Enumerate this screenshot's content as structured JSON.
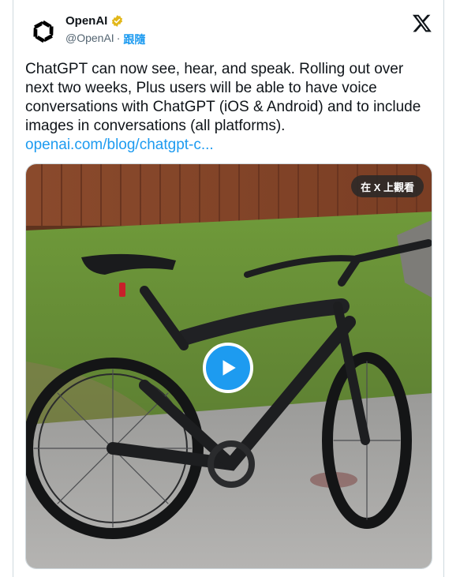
{
  "author": {
    "name": "OpenAI",
    "handle": "@OpenAI",
    "separator": "·",
    "follow_label": "跟隨",
    "verified_color": "#e2b719"
  },
  "tweet": {
    "text": "ChatGPT can now see, hear, and speak. Rolling out over next two weeks, Plus users will be able to have voice conversations with ChatGPT (iOS & Android) and to include images in conversations (all platforms).",
    "link": "openai.com/blog/chatgpt-c..."
  },
  "media": {
    "watch_label": "在 X 上觀看",
    "play_icon": "play-icon",
    "accent": "#1d9bf0"
  },
  "icons": {
    "brand": "openai-logo-icon",
    "close": "x-logo-icon",
    "verified": "verified-badge-icon"
  }
}
